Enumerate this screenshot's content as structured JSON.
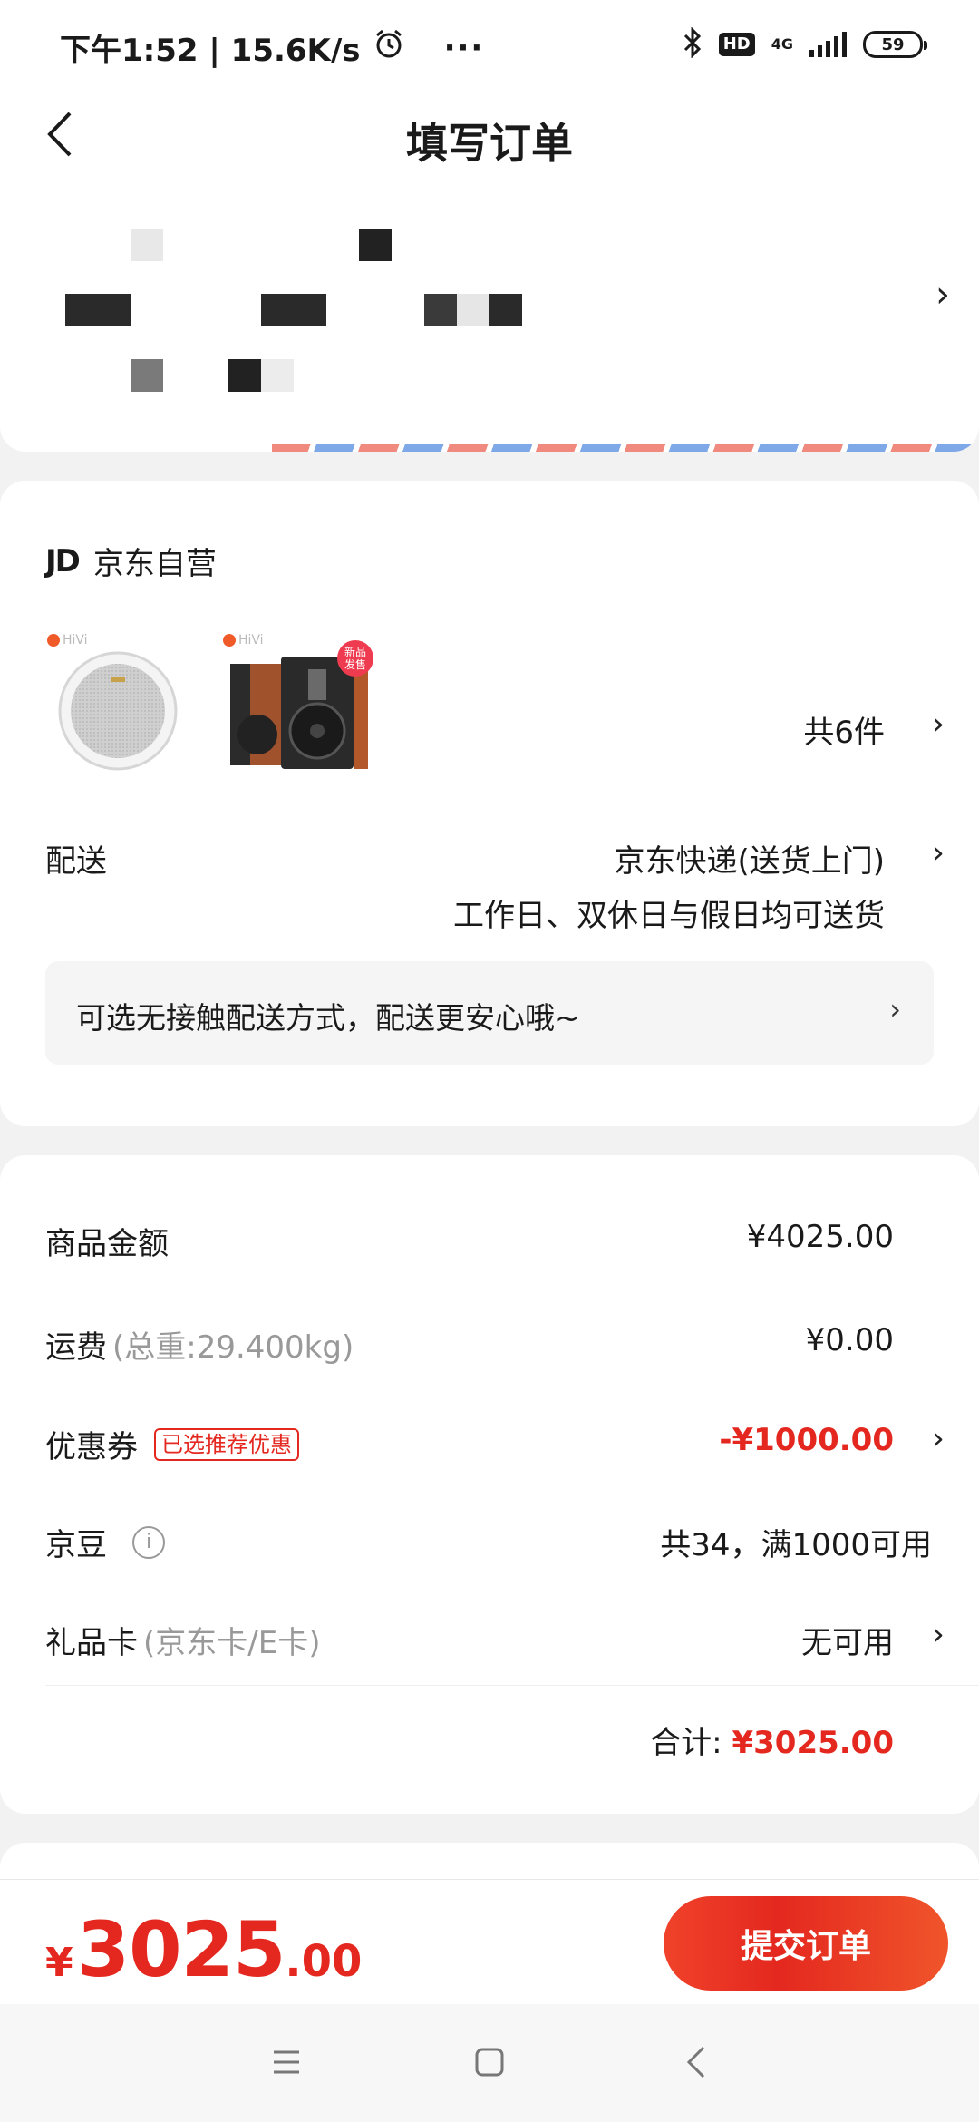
{
  "status_bar": {
    "time_speed": "下午1:52 | 15.6K/s",
    "more": "···",
    "hd": "HD",
    "network": "4G",
    "battery": "59"
  },
  "header": {
    "title": "填写订单"
  },
  "address": {
    "arrow": "›"
  },
  "shop": {
    "logo": "JD",
    "name": "京东自营",
    "brand_logo": "HiVi",
    "new_badge": "新品发售",
    "item_count": "共6件",
    "delivery": {
      "label": "配送",
      "method": "京东快递(送货上门)",
      "days": "工作日、双休日与假日均可送货"
    },
    "contactless": "可选无接触配送方式，配送更安心哦~"
  },
  "price": {
    "goods_label": "商品金额",
    "goods_value": "¥4025.00",
    "freight_label": "运费",
    "freight_weight": "(总重:29.400kg)",
    "freight_value": "¥0.00",
    "coupon_label": "优惠券",
    "coupon_tag": "已选推荐优惠",
    "coupon_value": "-¥1000.00",
    "beans_label": "京豆",
    "beans_value": "共34，满1000可用",
    "giftcard_label": "礼品卡",
    "giftcard_hint": "(京东卡/E卡)",
    "giftcard_value": "无可用",
    "total_label": "合计:",
    "total_value": "¥3025.00"
  },
  "bottom": {
    "yen": "¥",
    "int": "3025",
    "dec": ".00",
    "submit": "提交订单"
  },
  "colors": {
    "accent_red": "#e4281f",
    "background": "#f2f2f2"
  }
}
